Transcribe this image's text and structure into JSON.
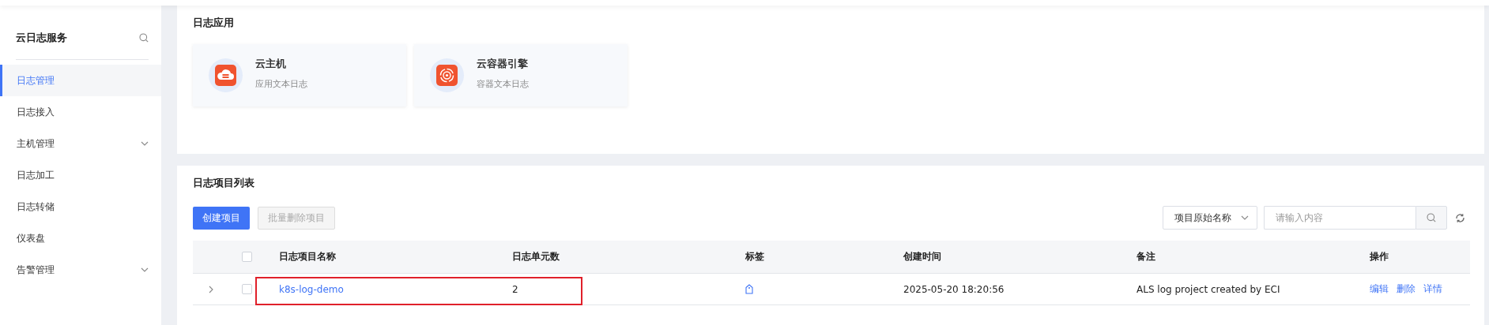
{
  "sidebar": {
    "title": "云日志服务",
    "items": [
      {
        "label": "日志管理",
        "selected": true,
        "has_children": false
      },
      {
        "label": "日志接入",
        "selected": false,
        "has_children": false
      },
      {
        "label": "主机管理",
        "selected": false,
        "has_children": true
      },
      {
        "label": "日志加工",
        "selected": false,
        "has_children": false
      },
      {
        "label": "日志转储",
        "selected": false,
        "has_children": false
      },
      {
        "label": "仪表盘",
        "selected": false,
        "has_children": false
      },
      {
        "label": "告警管理",
        "selected": false,
        "has_children": true
      }
    ]
  },
  "apps": {
    "title": "日志应用",
    "cards": [
      {
        "kind": "cloud",
        "name": "云主机",
        "description": "应用文本日志"
      },
      {
        "kind": "engine",
        "name": "云容器引擎",
        "description": "容器文本日志"
      }
    ]
  },
  "projects": {
    "title": "日志项目列表",
    "create_button": "创建项目",
    "batch_delete_button": {
      "label": "批量删除项目",
      "disabled": true
    },
    "filter_select": "项目原始名称",
    "search": {
      "placeholder": "请输入内容"
    },
    "table": {
      "header_checked": false,
      "columns": [
        "日志项目名称",
        "日志单元数",
        "标签",
        "创建时间",
        "备注",
        "操作"
      ],
      "rows": [
        {
          "expanded": false,
          "checked": false,
          "highlighted": true,
          "name": "k8s-log-demo",
          "units": "2",
          "created": "2025-05-20 18:20:56",
          "remark": "ALS log project created by ECI",
          "actions": [
            "编辑",
            "删除",
            "详情"
          ]
        }
      ]
    }
  }
}
